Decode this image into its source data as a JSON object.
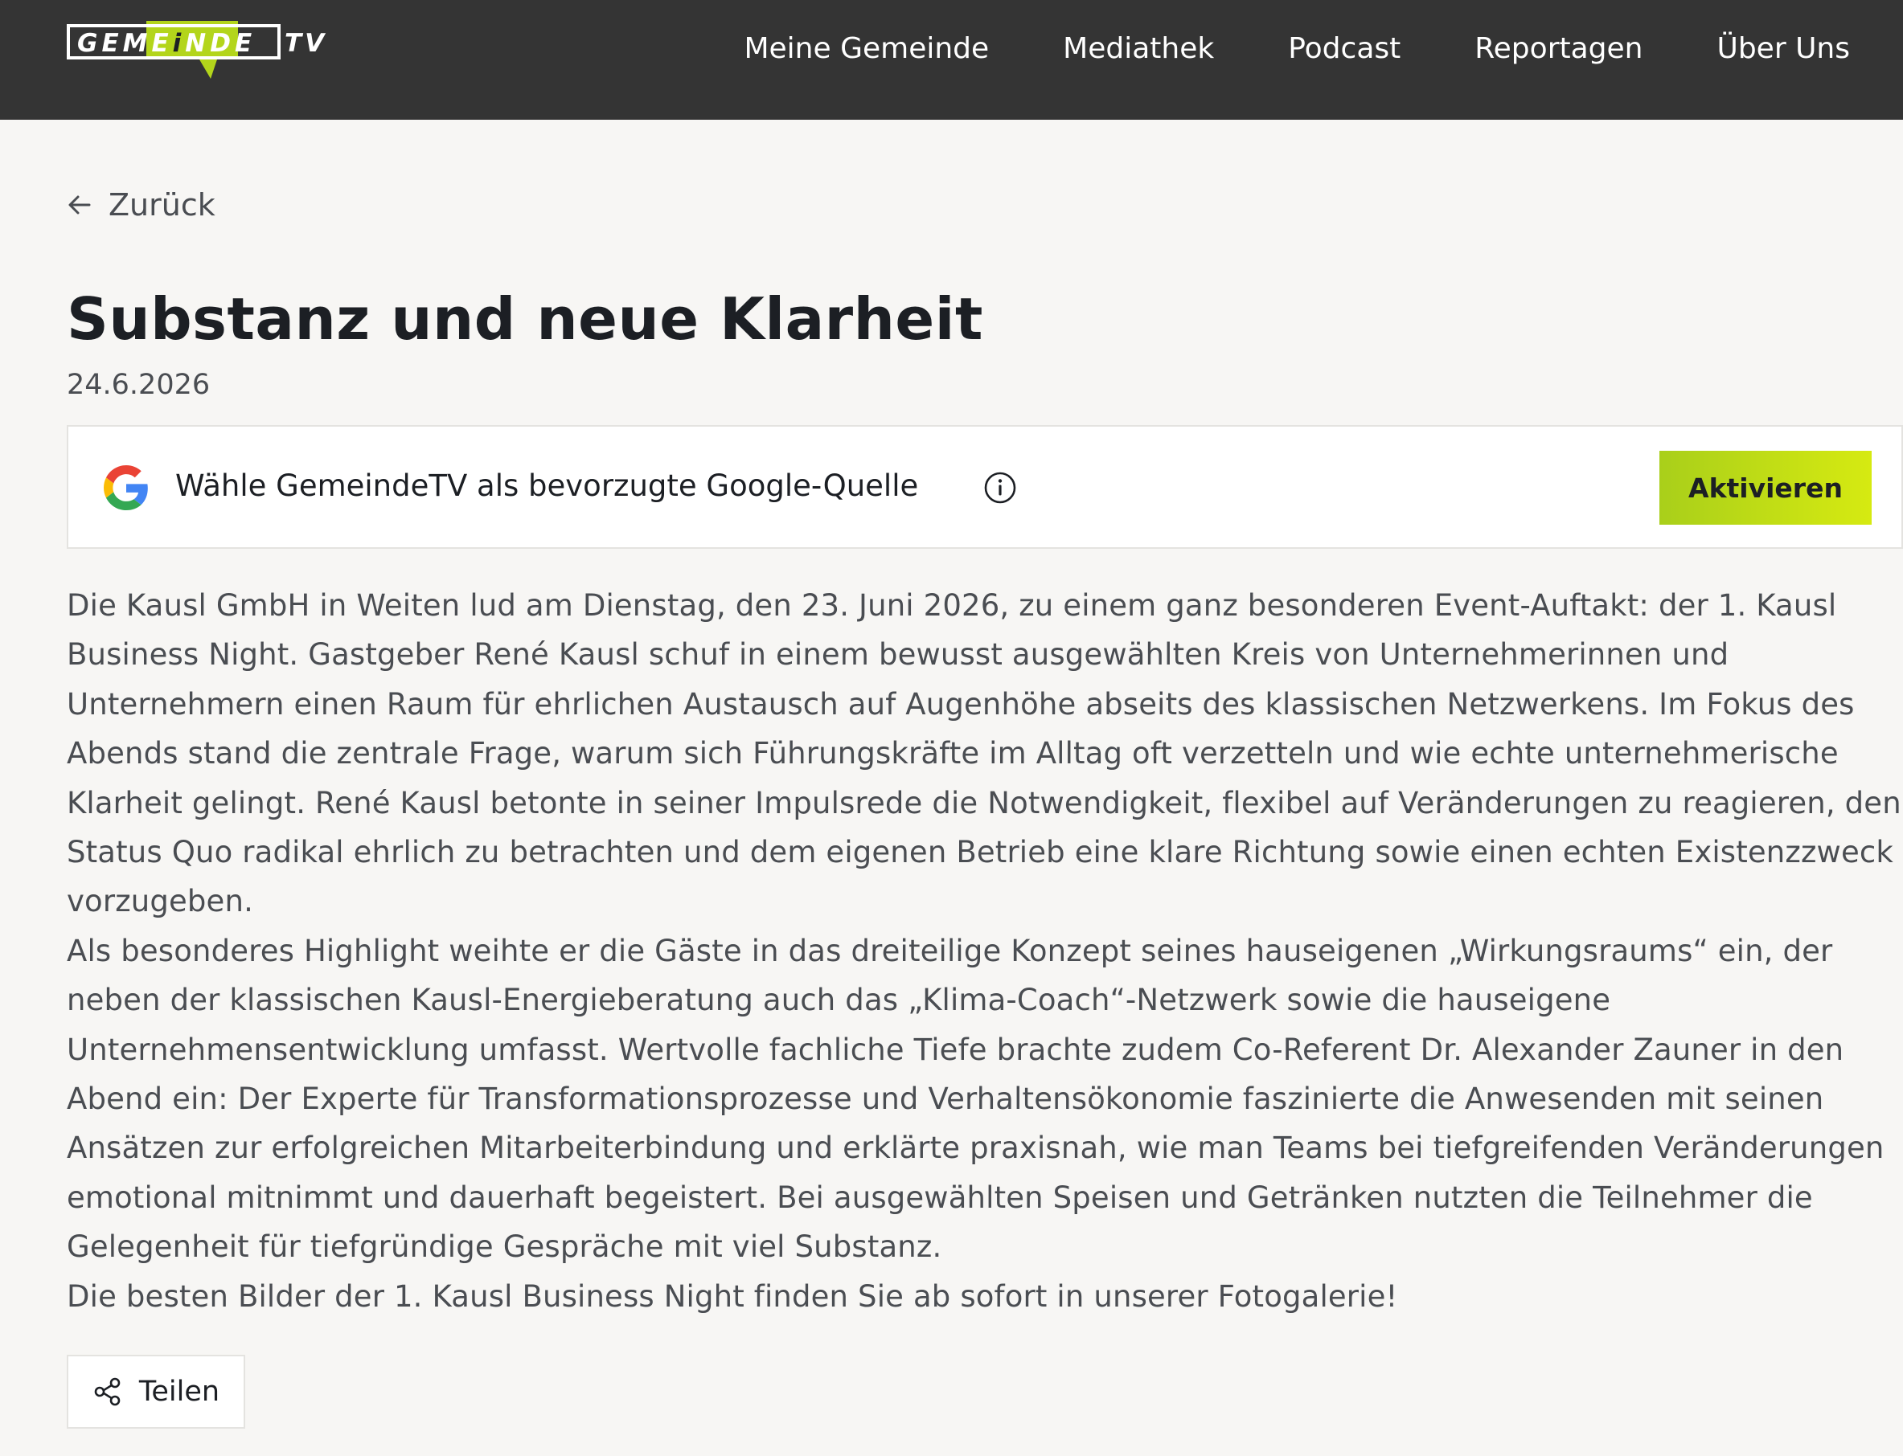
{
  "header": {
    "logo": {
      "left": "GEME",
      "i": "i",
      "mid": "NDE",
      "right": "TV"
    },
    "nav": [
      {
        "label": "Meine Gemeinde"
      },
      {
        "label": "Mediathek"
      },
      {
        "label": "Podcast"
      },
      {
        "label": "Reportagen"
      },
      {
        "label": "Über Uns"
      }
    ]
  },
  "back": {
    "label": "Zurück",
    "icon": "arrow-left-icon"
  },
  "article": {
    "title": "Substanz und neue Klarheit",
    "date": "24.6.2026",
    "paragraphs": [
      "Die Kausl GmbH in Weiten lud am Dienstag, den 23. Juni 2026, zu einem ganz besonderen Event-Auftakt: der 1. Kausl Business Night. Gastgeber René Kausl schuf in einem bewusst ausgewählten Kreis von Unternehmerinnen und Unternehmern einen Raum für ehrlichen Austausch auf Augenhöhe abseits des klassischen Netzwerkens. Im Fokus des Abends stand die zentrale Frage, warum sich Führungskräfte im Alltag oft verzetteln und wie echte unternehmerische Klarheit gelingt. René Kausl betonte in seiner Impulsrede die Notwendigkeit, flexibel auf Veränderungen zu reagieren, den Status Quo radikal ehrlich zu betrachten und dem eigenen Betrieb eine klare Richtung sowie einen echten Existenzzweck vorzugeben.",
      "Als besonderes Highlight weihte er die Gäste in das dreiteilige Konzept seines hauseigenen „Wirkungsraums“ ein, der neben der klassischen Kausl-Energieberatung auch das „Klima-Coach“-Netzwerk sowie die hauseigene Unternehmensentwicklung umfasst. Wertvolle fachliche Tiefe brachte zudem Co-Referent Dr. Alexander Zauner in den Abend ein: Der Experte für Transformationsprozesse und Verhaltensökonomie faszinierte die Anwesenden mit seinen Ansätzen zur erfolgreichen Mitarbeiterbindung und erklärte praxisnah, wie man Teams bei tiefgreifenden Veränderungen emotional mitnimmt und dauerhaft begeistert. Bei ausgewählten Speisen und Getränken nutzten die Teilnehmer die Gelegenheit für tiefgründige Gespräche mit viel Substanz.",
      "Die besten Bilder der 1. Kausl Business Night finden Sie ab sofort in unserer Fotogalerie!"
    ]
  },
  "google_source": {
    "text": "Wähle GemeindeTV als bevorzugte Google-Quelle",
    "button_label": "Aktivieren",
    "icons": [
      "google-g-icon",
      "info-icon"
    ]
  },
  "share": {
    "label": "Teilen",
    "icon": "share-icon"
  },
  "colors": {
    "topbar": "#343434",
    "background": "#f7f6f4",
    "accent_start": "#a9cf1a",
    "accent_end": "#d6ea11",
    "text_dark": "#1c1f24",
    "text_muted": "#4a4d52"
  }
}
